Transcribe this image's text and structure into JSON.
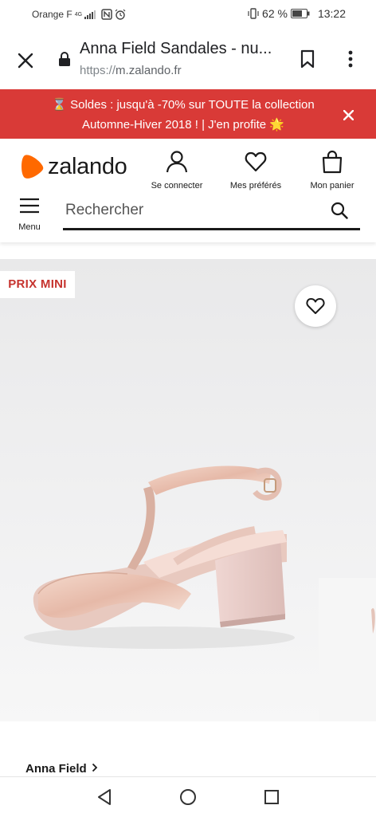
{
  "status_bar": {
    "carrier": "Orange F",
    "network": "4G",
    "battery": "62 %",
    "time": "13:22"
  },
  "browser": {
    "page_title": "Anna Field Sandales - nu...",
    "url_protocol": "https://",
    "url_host": "m.zalando.fr"
  },
  "promo": {
    "line1": "Soldes : jusqu'à -70% sur TOUTE la collection",
    "line2": "Automne-Hiver 2018 ! | J'en profite",
    "hourglass": "⌛",
    "star": "🌟"
  },
  "header": {
    "logo_text": "zalando",
    "login_label": "Se connecter",
    "wishlist_label": "Mes préférés",
    "cart_label": "Mon panier",
    "menu_label": "Menu",
    "search_placeholder": "Rechercher"
  },
  "product": {
    "badge": "PRIX MINI",
    "brand": "Anna Field"
  },
  "colors": {
    "promo_bg": "#d93a37",
    "logo_orange": "#ff6900",
    "badge_text": "#c6332e",
    "image_bg": "#ededee"
  }
}
